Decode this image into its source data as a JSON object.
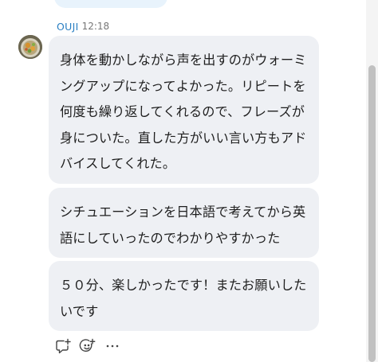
{
  "sender": {
    "name": "OUJI",
    "time": "12:18"
  },
  "messages": [
    {
      "text": "身体を動かしながら声を出すのがウォーミングアップになってよかった。リピートを何度も繰り返してくれるので、フレーズが身についた。直した方がいい言い方もアドバイスしてくれた。"
    },
    {
      "text": "シチュエーションを日本語で考えてから英語にしていったのでわかりやすかった"
    },
    {
      "text": "５０分、楽しかったです！またお願いしたいです"
    }
  ],
  "reactions": {
    "reply_icon": "comment-plus-icon",
    "emoji_icon": "emoji-plus-icon",
    "more_icon": "ellipsis-icon"
  },
  "colors": {
    "sender_name": "#2a7fc2",
    "bubble_background": "#eef0f4",
    "text": "#1e1e1e",
    "timestamp": "#777777",
    "scroll_thumb": "#c1c1c1"
  }
}
